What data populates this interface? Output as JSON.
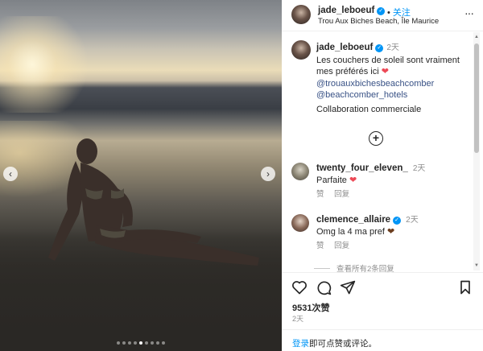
{
  "post": {
    "author": "jade_leboeuf",
    "follow_label": "关注",
    "dot_separator": "•",
    "location": "Trou Aux Biches Beach, Île Maurice",
    "more_glyph": "···"
  },
  "caption": {
    "author": "jade_leboeuf",
    "time": "2天",
    "text": "Les couchers de soleil sont vraiment mes préférés ici",
    "heart": "❤",
    "mentions": [
      "@trouauxbichesbeachcomber",
      "@beachcomber_hotels"
    ],
    "collab": "Collaboration commerciale",
    "load_more_glyph": "+"
  },
  "comments": [
    {
      "author": "twenty_four_eleven_",
      "time": "2天",
      "text": "Parfaite",
      "emoji": "❤",
      "like_label": "赞",
      "reply_label": "回复"
    },
    {
      "author": "clemence_allaire",
      "time": "2天",
      "text": "Omg la 4 ma pref",
      "emoji": "❤",
      "like_label": "赞",
      "reply_label": "回复",
      "view_replies": "查看所有2条回复"
    }
  ],
  "stats": {
    "likes": "9531次赞",
    "posted": "2天"
  },
  "footer": {
    "login_link": "登录",
    "login_text": "即可点赞或评论。"
  },
  "carousel": {
    "total": 9,
    "active_index": 4
  },
  "icons": {
    "prev": "chevron-left-icon",
    "next": "chevron-right-icon",
    "like": "heart-icon",
    "comment": "comment-icon",
    "share": "send-icon",
    "save": "bookmark-icon",
    "more": "more-icon",
    "verified": "verified-icon",
    "load_more": "plus-circle-icon"
  },
  "colors": {
    "accent": "#0095f6",
    "heart": "#ed4956",
    "brown_heart": "#6b3d1e",
    "muted": "#8e8e8e"
  }
}
